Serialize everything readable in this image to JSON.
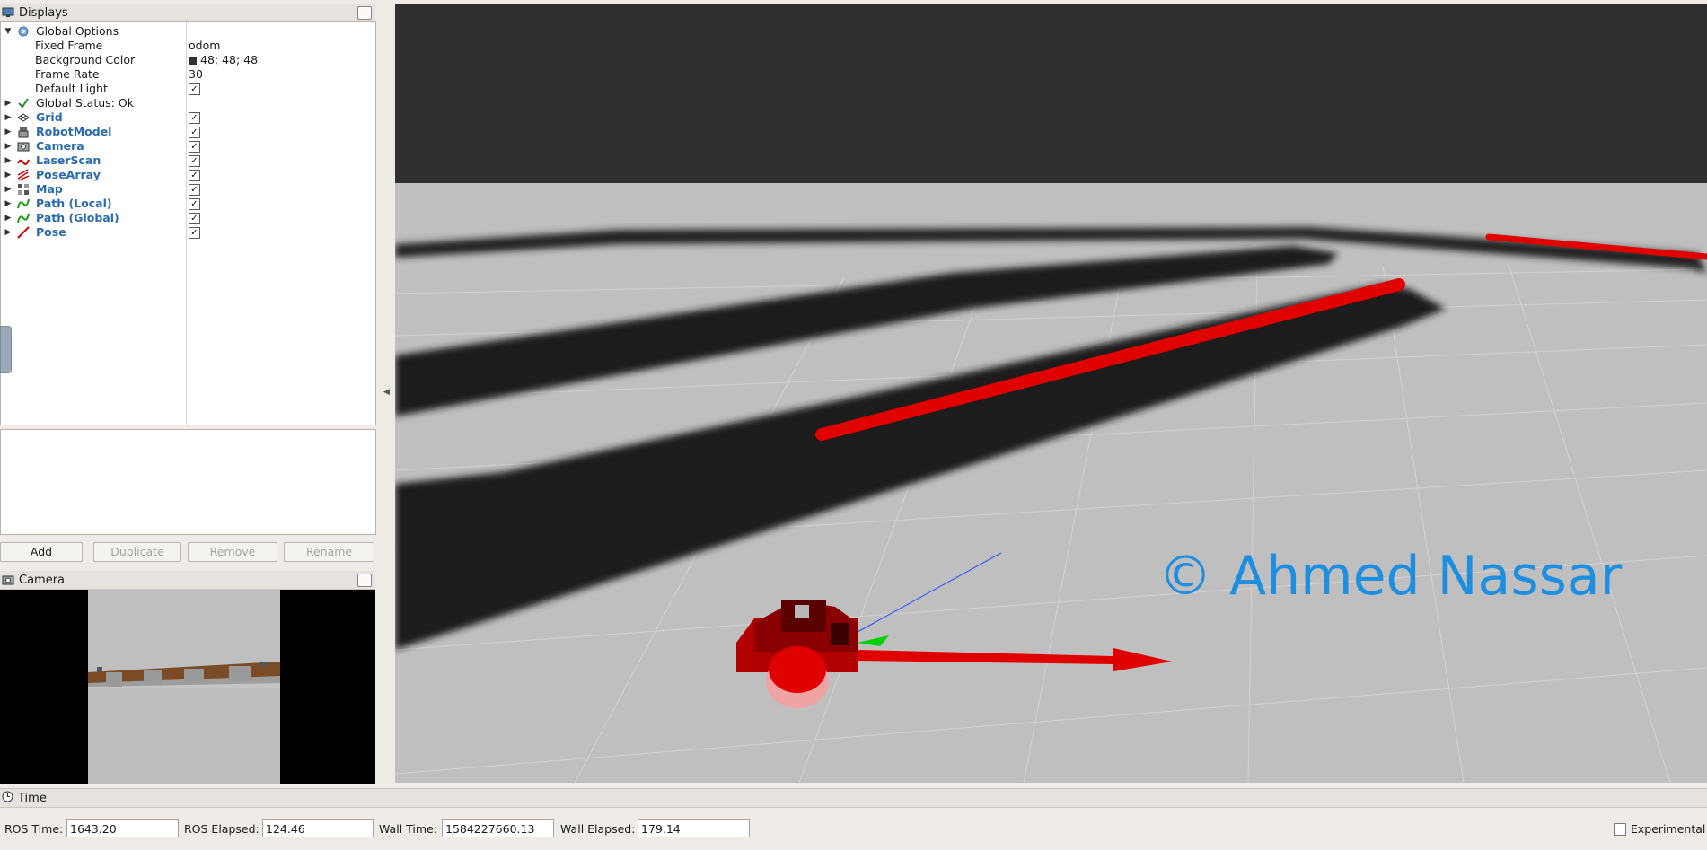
{
  "displays_panel": {
    "title": "Displays",
    "global_options": {
      "label": "Global Options",
      "fixed_frame_label": "Fixed Frame",
      "fixed_frame_value": "odom",
      "background_color_label": "Background Color",
      "background_color_value": "48; 48; 48",
      "background_color_hex": "#303030",
      "frame_rate_label": "Frame Rate",
      "frame_rate_value": "30",
      "default_light_label": "Default Light",
      "default_light_checked": true
    },
    "global_status": "Global Status: Ok",
    "plugins": [
      {
        "label": "Grid",
        "icon": "grid-icon",
        "checked": true
      },
      {
        "label": "RobotModel",
        "icon": "robot-model-icon",
        "checked": true
      },
      {
        "label": "Camera",
        "icon": "camera-icon",
        "checked": true
      },
      {
        "label": "LaserScan",
        "icon": "laser-scan-icon",
        "checked": true
      },
      {
        "label": "PoseArray",
        "icon": "pose-array-icon",
        "checked": true
      },
      {
        "label": "Map",
        "icon": "map-icon",
        "checked": true
      },
      {
        "label": "Path (Local)",
        "icon": "path-icon",
        "checked": true
      },
      {
        "label": "Path (Global)",
        "icon": "path-icon",
        "checked": true
      },
      {
        "label": "Pose",
        "icon": "pose-icon",
        "checked": true
      }
    ],
    "buttons": {
      "add": "Add",
      "duplicate": "Duplicate",
      "remove": "Remove",
      "rename": "Rename"
    }
  },
  "camera_panel": {
    "title": "Camera"
  },
  "viewport": {
    "watermark": "© Ahmed Nassar",
    "watermark_color": "#1e8fe0"
  },
  "time_panel": {
    "title": "Time",
    "ros_time_label": "ROS Time:",
    "ros_time_value": "1643.20",
    "ros_elapsed_label": "ROS Elapsed:",
    "ros_elapsed_value": "124.46",
    "wall_time_label": "Wall Time:",
    "wall_time_value": "1584227660.13",
    "wall_elapsed_label": "Wall Elapsed:",
    "wall_elapsed_value": "179.14",
    "experimental_label": "Experimental"
  }
}
